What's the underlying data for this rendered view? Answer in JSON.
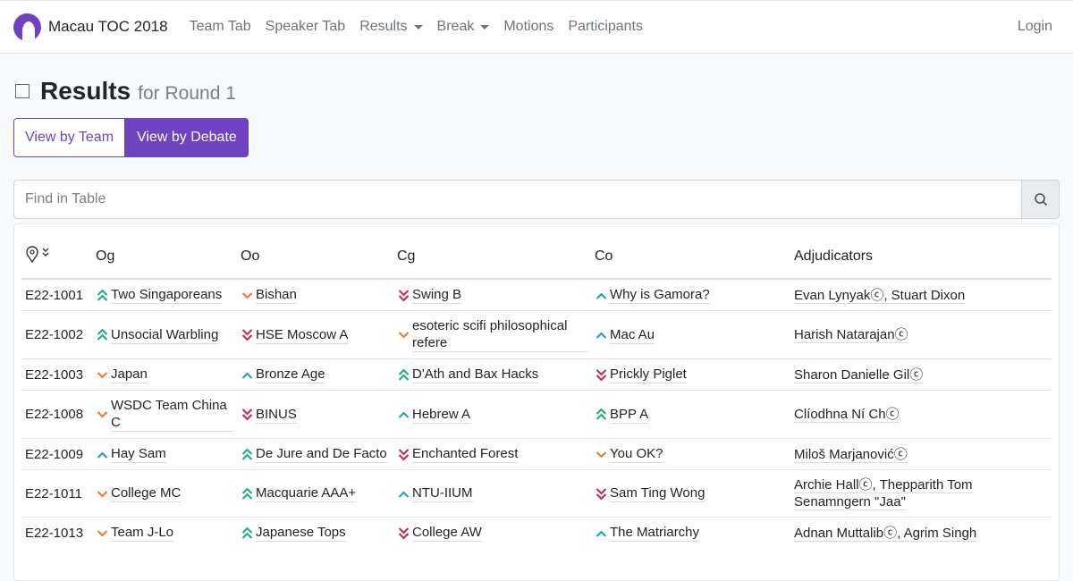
{
  "nav": {
    "brand": "Macau TOC 2018",
    "items": [
      "Team Tab",
      "Speaker Tab",
      "Results",
      "Break",
      "Motions",
      "Participants"
    ],
    "dropdowns": [
      false,
      false,
      true,
      true,
      false,
      false
    ],
    "login": "Login"
  },
  "page": {
    "title": "Results",
    "subtitle": "for Round 1"
  },
  "toggle": {
    "team": "View by Team",
    "debate": "View by Debate"
  },
  "search": {
    "placeholder": "Find in Table"
  },
  "colors": {
    "accent": "#6f42c1",
    "first": "#1aab8a",
    "second": "#1aa1a1",
    "third": "#f0742e",
    "fourth": "#c7254e"
  },
  "table": {
    "headers": [
      "Og",
      "Oo",
      "Cg",
      "Co",
      "Adjudicators"
    ],
    "rows": [
      {
        "room": "E22-1001",
        "teams": [
          [
            "Two Singaporeans",
            1
          ],
          [
            "Bishan",
            3
          ],
          [
            "Swing B",
            4
          ],
          [
            "Why is Gamora?",
            2
          ]
        ],
        "adj": "Evan Lynyakⓒ, Stuart Dixon"
      },
      {
        "room": "E22-1002",
        "teams": [
          [
            "Unsocial Warbling",
            1
          ],
          [
            "HSE Moscow A",
            4
          ],
          [
            "esoteric scifi philosophical refere",
            3
          ],
          [
            "Mac Au",
            2
          ]
        ],
        "adj": "Harish Natarajanⓒ"
      },
      {
        "room": "E22-1003",
        "teams": [
          [
            "Japan",
            3
          ],
          [
            "Bronze Age",
            2
          ],
          [
            "D'Ath and Bax Hacks",
            1
          ],
          [
            "Prickly Piglet",
            4
          ]
        ],
        "adj": "Sharon Danielle Gilⓒ"
      },
      {
        "room": "E22-1008",
        "teams": [
          [
            "WSDC Team China C",
            3
          ],
          [
            "BINUS",
            4
          ],
          [
            "Hebrew A",
            2
          ],
          [
            "BPP A",
            1
          ]
        ],
        "adj": "Clíodhna Ní Chⓒ"
      },
      {
        "room": "E22-1009",
        "teams": [
          [
            "Hay Sam",
            2
          ],
          [
            "De Jure and De Facto",
            1
          ],
          [
            "Enchanted Forest",
            4
          ],
          [
            "You OK?",
            3
          ]
        ],
        "adj": "Miloš Marjanovićⓒ"
      },
      {
        "room": "E22-1011",
        "teams": [
          [
            "College MC",
            3
          ],
          [
            "Macquarie AAA+",
            1
          ],
          [
            "NTU-IIUM",
            2
          ],
          [
            "Sam Ting Wong",
            4
          ]
        ],
        "adj": "Archie Hallⓒ, Thepparith Tom Senamngern \"Jaa\""
      },
      {
        "room": "E22-1013",
        "teams": [
          [
            "Team J-Lo",
            3
          ],
          [
            "Japanese Tops",
            1
          ],
          [
            "College AW",
            4
          ],
          [
            "The Matriarchy",
            2
          ]
        ],
        "adj": "Adnan Muttalibⓒ, Agrim Singh"
      }
    ]
  }
}
